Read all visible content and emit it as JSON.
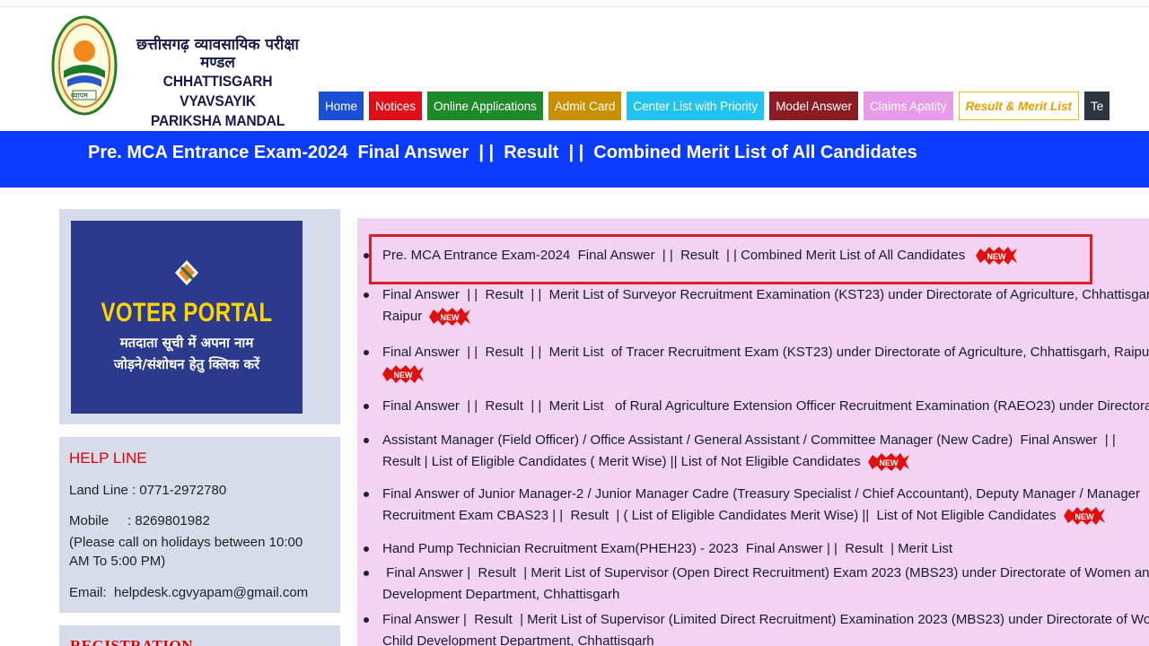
{
  "header": {
    "org_name_hi": "छत्तीसगढ़ व्यावसायिक परीक्षा मण्डल",
    "org_name_en_1": "CHHATTISGARH VYAVSAYIK",
    "org_name_en_2": "PARIKSHA MANDAL",
    "logo_text": "व्यापम"
  },
  "nav": {
    "items": [
      {
        "label": "Home",
        "color": "#1a4fd6"
      },
      {
        "label": "Notices",
        "color": "#e0101a"
      },
      {
        "label": "Online Applications",
        "color": "#1f8a2a"
      },
      {
        "label": "Admit Card",
        "color": "#c89000"
      },
      {
        "label": "Center List with Priority",
        "color": "#22c3f0"
      },
      {
        "label": "Model Answer",
        "color": "#8a1c22"
      },
      {
        "label": "Claims Apatity",
        "color": "#e79be8"
      },
      {
        "label": "Result & Merit List",
        "color": "#ffffff"
      },
      {
        "label": "Te",
        "color": "#2c3540"
      }
    ]
  },
  "banner": {
    "text": "Pre. MCA Entrance Exam-2024  Final Answer  | |  Result  | |  Combined Merit List of All Candidates"
  },
  "voter_portal": {
    "title": "VOTER PORTAL",
    "line1": "मतदाता सूची में अपना नाम",
    "line2": "जोड़ने/संशोधन हेतु क्लिक करें"
  },
  "helpline": {
    "title": "HELP LINE",
    "landline": "Land Line : 0771-2972780",
    "mobile": "Mobile     : 8269801982",
    "note1": "(Please call on holidays between 10:00",
    "note2": "AM To 5:00 PM)",
    "email": "Email:  helpdesk.cgvyapam@gmail.com"
  },
  "registration": {
    "title": "REGISTRATION"
  },
  "badge": {
    "text": "NEW"
  },
  "news": [
    {
      "line1": "Pre. MCA Entrance Exam-2024  Final Answer  | |  Result  | | Combined Merit List of All Candidates",
      "line2": "",
      "badge_on_line": 1
    },
    {
      "line1": "Final Answer  | |  Result  | |  Merit List of Surveyor Recruitment Examination (KST23) under Directorate of Agriculture, Chhattisgarh,",
      "line2": "Raipur",
      "badge_on_line": 2
    },
    {
      "line1": "Final Answer  | |  Result  | |  Merit List  of Tracer Recruitment Exam (KST23) under Directorate of Agriculture, Chhattisgarh, Raipur",
      "line2": "",
      "badge_on_line": 2
    },
    {
      "line1": "Final Answer  | |  Result  | |  Merit List   of Rural Agriculture Extension Officer Recruitment Examination (RAEO23) under Directorate",
      "line2": "",
      "badge_on_line": 0
    },
    {
      "line1": "Assistant Manager (Field Officer) / Office Assistant / General Assistant / Committee Manager (New Cadre)  Final Answer  | |",
      "line2": "Result  | List of Eligible Candidates ( Merit Wise) || List of Not Eligible Candidates",
      "badge_on_line": 2
    },
    {
      "line1": "Final Answer of Junior Manager-2 / Junior Manager Cadre (Treasury Specialist / Chief Accountant), Deputy Manager / Manager",
      "line2": "Recruitment Exam CBAS23 | |  Result  | ( List of Eligible Candidates Merit Wise) ||  List of Not Eligible Candidates",
      "badge_on_line": 2
    },
    {
      "line1": "Hand Pump Technician Recruitment Exam(PHEH23) - 2023  Final Answer | |  Result  | Merit List",
      "line2": "",
      "badge_on_line": 0
    },
    {
      "line1": " Final Answer |  Result  | Merit List of Supervisor (Open Direct Recruitment) Exam 2023 (MBS23) under Directorate of Women and",
      "line2": "Development Department, Chhattisgarh",
      "badge_on_line": 0
    },
    {
      "line1": "Final Answer |  Result  | Merit List of Supervisor (Limited Direct Recruitment) Examination 2023 (MBS23) under Directorate of Women and",
      "line2": "Child Development Department, Chhattisgarh",
      "badge_on_line": 0
    }
  ]
}
